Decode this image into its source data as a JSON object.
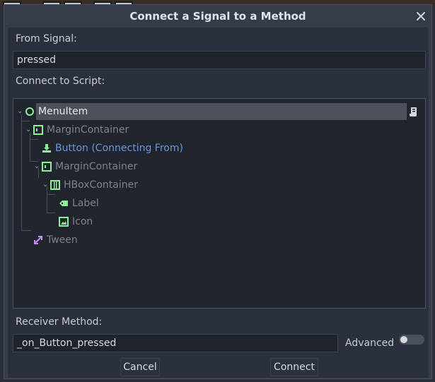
{
  "dialog": {
    "title": "Connect a Signal to a Method",
    "close_label": "×"
  },
  "from_signal": {
    "label": "From Signal:",
    "value": "pressed"
  },
  "connect_to_script": {
    "label": "Connect to Script:"
  },
  "tree": {
    "items": [
      {
        "label": "MenuItem",
        "icon": "circle-node-icon",
        "selected": true
      },
      {
        "label": "MarginContainer",
        "icon": "margin-container-icon"
      },
      {
        "label": "Button (Connecting From)",
        "icon": "button-node-icon",
        "source": true
      },
      {
        "label": "MarginContainer",
        "icon": "margin-container-icon"
      },
      {
        "label": "HBoxContainer",
        "icon": "hbox-container-icon"
      },
      {
        "label": "Label",
        "icon": "label-node-icon"
      },
      {
        "label": "Icon",
        "icon": "texture-rect-icon"
      },
      {
        "label": "Tween",
        "icon": "tween-node-icon"
      }
    ],
    "script_icon": "script-icon"
  },
  "receiver": {
    "label": "Receiver Method:",
    "value": "_on_Button_pressed",
    "advanced_label": "Advanced",
    "advanced_enabled": false
  },
  "buttons": {
    "cancel": "Cancel",
    "connect": "Connect"
  },
  "colors": {
    "node_green": "#8eef97",
    "source_blue": "#6c97d6",
    "tween_purple": "#c38ef1",
    "dim_text": "#7d828c",
    "selected_row": "#4b505a"
  }
}
